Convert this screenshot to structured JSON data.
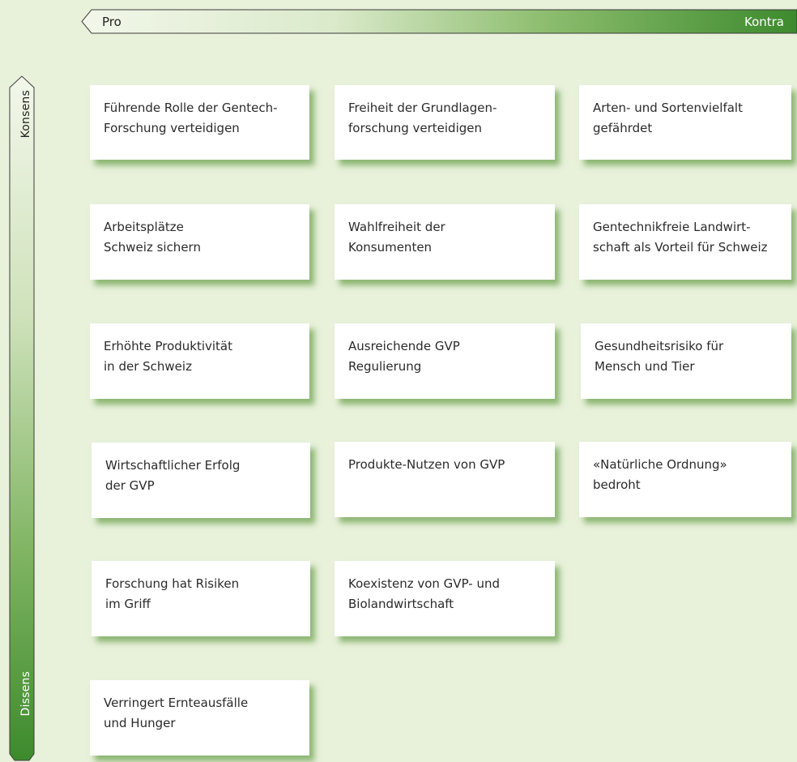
{
  "axis": {
    "pro": "Pro",
    "kontra": "Kontra",
    "konsens": "Konsens",
    "dissens": "Dissens"
  },
  "colors": {
    "background": "#e8f1da",
    "accent_dark": "#3f8a2e",
    "accent_light": "#f1f6ea"
  },
  "cards": {
    "pro": [
      {
        "lines": [
          "Führende Rolle der Gentech-",
          "Forschung verteidigen"
        ]
      },
      {
        "lines": [
          "Arbeitsplätze",
          "Schweiz sichern"
        ]
      },
      {
        "lines": [
          "Erhöhte Produktivität",
          "in der Schweiz"
        ]
      },
      {
        "lines": [
          "Wirtschaftlicher Erfolg",
          "der GVP"
        ]
      },
      {
        "lines": [
          "Forschung hat Risiken",
          "im Griff"
        ]
      },
      {
        "lines": [
          "Verringert Ernteausfälle",
          "und Hunger"
        ]
      }
    ],
    "middle": [
      {
        "lines": [
          "Freiheit der Grundlagen-",
          "forschung verteidigen"
        ]
      },
      {
        "lines": [
          "Wahlfreiheit der",
          "Konsumenten"
        ]
      },
      {
        "lines": [
          "Ausreichende GVP",
          "Regulierung"
        ]
      },
      {
        "lines": [
          "Produkte-Nutzen von GVP",
          ""
        ]
      },
      {
        "lines": [
          "Koexistenz von GVP- und",
          "Biolandwirtschaft"
        ]
      }
    ],
    "kontra": [
      {
        "lines": [
          "Arten- und Sortenvielfalt",
          "gefährdet"
        ]
      },
      {
        "lines": [
          "Gentechnikfreie Landwirt-",
          "schaft als Vorteil für Schweiz"
        ]
      },
      {
        "lines": [
          "Gesundheitsrisiko für",
          "Mensch und Tier"
        ]
      },
      {
        "lines": [
          "«Natürliche Ordnung»",
          "bedroht"
        ]
      }
    ]
  }
}
